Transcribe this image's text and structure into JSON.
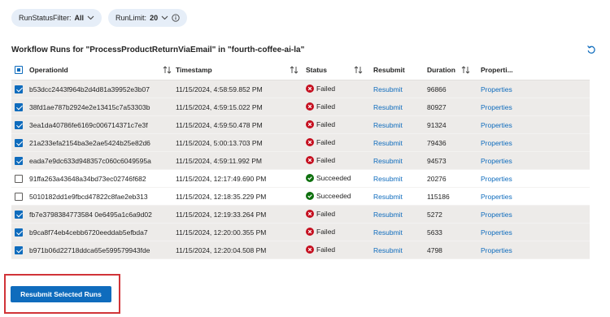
{
  "filters": {
    "status_label": "RunStatusFilter:",
    "status_value": "All",
    "limit_label": "RunLimit:",
    "limit_value": "20"
  },
  "title": "Workflow Runs for \"ProcessProductReturnViaEmail\" in \"fourth-coffee-ai-la\"",
  "columns": {
    "operation_id": "OperationId",
    "timestamp": "Timestamp",
    "status": "Status",
    "resubmit": "Resubmit",
    "duration": "Duration",
    "properties": "Properti..."
  },
  "rows": [
    {
      "selected": true,
      "operation_id": "b53dcc2443f964b2d4d81a39952e3b07",
      "timestamp": "11/15/2024, 4:58:59.852 PM",
      "status": "Failed",
      "resubmit": "Resubmit",
      "duration": "96866",
      "properties": "Properties"
    },
    {
      "selected": true,
      "operation_id": "38fd1ae787b2924e2e13415c7a53303b",
      "timestamp": "11/15/2024, 4:59:15.022 PM",
      "status": "Failed",
      "resubmit": "Resubmit",
      "duration": "80927",
      "properties": "Properties"
    },
    {
      "selected": true,
      "operation_id": "3ea1da40786fe6169c006714371c7e3f",
      "timestamp": "11/15/2024, 4:59:50.478 PM",
      "status": "Failed",
      "resubmit": "Resubmit",
      "duration": "91324",
      "properties": "Properties"
    },
    {
      "selected": true,
      "operation_id": "21a233efa2154ba3e2ae5424b25e82d6",
      "timestamp": "11/15/2024, 5:00:13.703 PM",
      "status": "Failed",
      "resubmit": "Resubmit",
      "duration": "79436",
      "properties": "Properties"
    },
    {
      "selected": true,
      "operation_id": "eada7e9dc633d948357c060c6049595a",
      "timestamp": "11/15/2024, 4:59:11.992 PM",
      "status": "Failed",
      "resubmit": "Resubmit",
      "duration": "94573",
      "properties": "Properties"
    },
    {
      "selected": false,
      "operation_id": "91ffa263a43648a34bd73ec02746f682",
      "timestamp": "11/15/2024, 12:17:49.690 PM",
      "status": "Succeeded",
      "resubmit": "Resubmit",
      "duration": "20276",
      "properties": "Properties"
    },
    {
      "selected": false,
      "operation_id": "5010182dd1e9fbcd47822c8fae2eb313",
      "timestamp": "11/15/2024, 12:18:35.229 PM",
      "status": "Succeeded",
      "resubmit": "Resubmit",
      "duration": "115186",
      "properties": "Properties"
    },
    {
      "selected": true,
      "operation_id": "fb7e3798384773584 0e6495a1c6a9d02",
      "timestamp": "11/15/2024, 12:19:33.264 PM",
      "status": "Failed",
      "resubmit": "Resubmit",
      "duration": "5272",
      "properties": "Properties"
    },
    {
      "selected": true,
      "operation_id": "b9ca8f74eb4cebb6720eeddab5efbda7",
      "timestamp": "11/15/2024, 12:20:00.355 PM",
      "status": "Failed",
      "resubmit": "Resubmit",
      "duration": "5633",
      "properties": "Properties"
    },
    {
      "selected": true,
      "operation_id": "b971b06d22718ddca65e599579943fde",
      "timestamp": "11/15/2024, 12:20:04.508 PM",
      "status": "Failed",
      "resubmit": "Resubmit",
      "duration": "4798",
      "properties": "Properties"
    }
  ],
  "actions": {
    "resubmit_selected": "Resubmit Selected Runs"
  },
  "colors": {
    "accent": "#0f6cbd",
    "failed": "#c50f1f",
    "succeeded": "#0e700e",
    "highlight_border": "#d13438"
  },
  "icons": {
    "filter_chevron": "chevron-down-icon",
    "info": "info-icon",
    "refresh": "refresh-icon",
    "sort": "sort-icon",
    "failed": "error-circle-icon",
    "succeeded": "check-circle-icon"
  }
}
